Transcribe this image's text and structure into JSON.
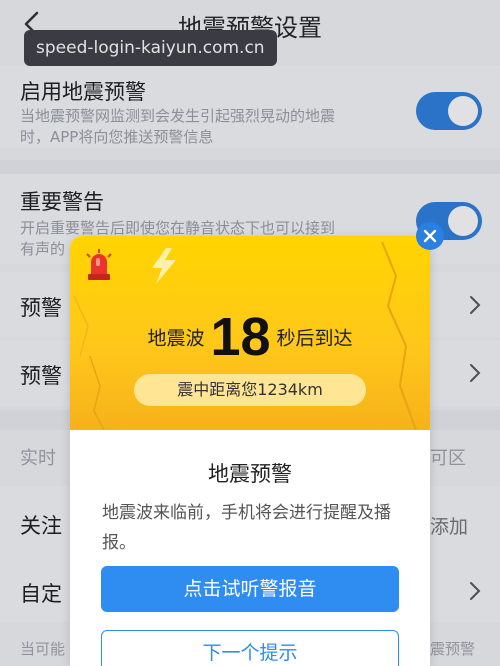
{
  "header": {
    "title": "地震预警设置"
  },
  "watermark": "speed-login-kaiyun.com.cn",
  "settings": {
    "enable": {
      "title": "启用地震预警",
      "desc_line1": "当地震预警网监测到会发生引起强烈晃动的地震",
      "desc_line2": "时，APP将向您推送预警信息",
      "on": true
    },
    "important": {
      "title": "重要警告",
      "desc_line1": "开启重要警告后即使您在静音状态下也可以接到",
      "desc_line2": "有声的",
      "on": true
    },
    "row3_title": "预警",
    "row4_title": "预警",
    "realtime_note": "实时",
    "realtime_right": "可区",
    "follow": {
      "title": "关注",
      "right": "添加"
    },
    "custom": {
      "title": "自定"
    },
    "footer_left": "当可能",
    "footer_right": "震预警"
  },
  "modal": {
    "countdown_prefix": "地震波",
    "countdown_seconds": "18",
    "countdown_suffix": "秒后到达",
    "distance_text": "震中距离您1234km",
    "heading": "地震预警",
    "body": "地震波来临前，手机将会进行提醒及播报。",
    "primary_button": "点击试听警报音",
    "secondary_button": "下一个提示"
  },
  "colors": {
    "accent": "#2f8cf0",
    "hero": "#ffd400",
    "toggle_on": "#2a7fe0"
  }
}
